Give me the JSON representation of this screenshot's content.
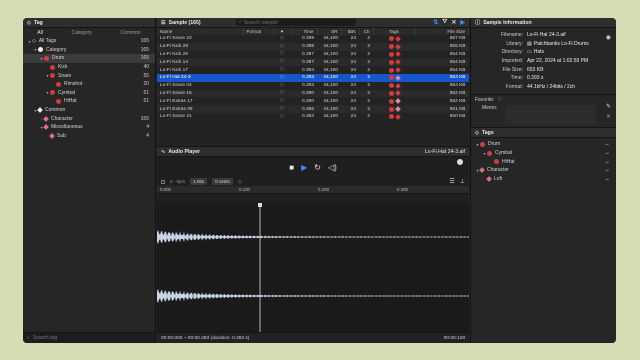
{
  "left": {
    "title": "Tag",
    "tabs": [
      "All",
      "Category",
      "Common"
    ],
    "tree": [
      {
        "indent": 0,
        "chev": "▾",
        "icon": "tag",
        "label": "All Tags",
        "count": "165"
      },
      {
        "indent": 1,
        "chev": "▾",
        "icon": "white",
        "label": "Category",
        "count": "165"
      },
      {
        "indent": 2,
        "chev": "▾",
        "icon": "red",
        "label": "Drum",
        "count": "165",
        "sel": true
      },
      {
        "indent": 3,
        "chev": "",
        "icon": "red",
        "label": "Kick",
        "count": "40"
      },
      {
        "indent": 3,
        "chev": "▾",
        "icon": "red",
        "label": "Snare",
        "count": "55"
      },
      {
        "indent": 4,
        "chev": "",
        "icon": "red",
        "label": "Rimshot",
        "count": "20"
      },
      {
        "indent": 3,
        "chev": "▾",
        "icon": "red",
        "label": "Cymbal",
        "count": "51"
      },
      {
        "indent": 4,
        "chev": "",
        "icon": "red",
        "label": "HiHat",
        "count": "51"
      },
      {
        "indent": 1,
        "chev": "▾",
        "icon": "diamond-white",
        "label": "Common",
        "count": ""
      },
      {
        "indent": 2,
        "chev": "›",
        "icon": "pink",
        "label": "Character",
        "count": "165"
      },
      {
        "indent": 2,
        "chev": "▾",
        "icon": "pink",
        "label": "Miscellaneous",
        "count": "4"
      },
      {
        "indent": 3,
        "chev": "",
        "icon": "pink",
        "label": "Sub",
        "count": "4"
      }
    ],
    "search_placeholder": "Search tag"
  },
  "sample": {
    "title": "Sample (165)",
    "search_placeholder": "Search sample",
    "columns": [
      "Name",
      "Format",
      "♥",
      "Time",
      "SR",
      "Bits",
      "Ch",
      "Tags",
      "File Size"
    ],
    "rows": [
      {
        "name": "Lo-Fi Snare 23",
        "time": "0.399",
        "sr": "44,100",
        "bits": "24",
        "ch": "2",
        "size": "657 KB",
        "tags": "dd"
      },
      {
        "name": "Lo-Fi Kick 29",
        "time": "0.398",
        "sr": "44,100",
        "bits": "24",
        "ch": "2",
        "size": "655 KB",
        "tags": "dd"
      },
      {
        "name": "Lo-Fi Kick 25",
        "time": "0.397",
        "sr": "44,100",
        "bits": "24",
        "ch": "2",
        "size": "654 KB",
        "tags": "dd"
      },
      {
        "name": "Lo-Fi Kick 14",
        "time": "0.397",
        "sr": "44,100",
        "bits": "24",
        "ch": "2",
        "size": "654 KB",
        "tags": "dd"
      },
      {
        "name": "Lo-Fi Kick 17",
        "time": "0.394",
        "sr": "44,100",
        "bits": "24",
        "ch": "2",
        "size": "654 KB",
        "tags": "dd"
      },
      {
        "name": "Lo-Fi Hat 24-3",
        "time": "0.393",
        "sr": "44,100",
        "bits": "24",
        "ch": "2",
        "size": "653 KB",
        "tags": "dp",
        "sel": true
      },
      {
        "name": "Lo-Fi Snare 04",
        "time": "0.393",
        "sr": "44,100",
        "bits": "24",
        "ch": "2",
        "size": "653 KB",
        "tags": "dd"
      },
      {
        "name": "Lo-Fi Snare 16",
        "time": "0.390",
        "sr": "44,100",
        "bits": "24",
        "ch": "2",
        "size": "652 KB",
        "tags": "dd"
      },
      {
        "name": "Lo-Fi Extras 17",
        "time": "0.390",
        "sr": "44,100",
        "bits": "24",
        "ch": "2",
        "size": "652 KB",
        "tags": "dp"
      },
      {
        "name": "Lo-Fi Extras 08",
        "time": "0.386",
        "sr": "44,100",
        "bits": "24",
        "ch": "2",
        "size": "651 KB",
        "tags": "dp"
      },
      {
        "name": "Lo-Fi Snare 21",
        "time": "0.383",
        "sr": "44,100",
        "bits": "24",
        "ch": "2",
        "size": "650 KB",
        "tags": "dd"
      }
    ]
  },
  "player": {
    "title": "Audio Player",
    "file": "Lo-Fi Hat 24-3.aif",
    "pan": "0 · 0pm",
    "speed": "1.00x",
    "pitch": "0 cents",
    "ruler": [
      "0.000",
      "0.100",
      "0.200",
      "0.300"
    ],
    "time_range": "00:00.000 ~ 00:00.393 (duration: 0.393 s)",
    "pos": "00:00:128"
  },
  "info": {
    "title": "Sample Information",
    "fields": [
      {
        "label": "Filename:",
        "value": "Lo-Fi Hat 24-3.aif"
      },
      {
        "label": "Library:",
        "value": "Patchbanks Lo-Fi Drums",
        "icon": "library"
      },
      {
        "label": "Directory:",
        "value": "Hats",
        "icon": "folder"
      },
      {
        "label": "Imported:",
        "value": "Apr 22, 2024 at 1:02:59 PM"
      },
      {
        "label": "File Size:",
        "value": "653 KB"
      },
      {
        "label": "Time:",
        "value": "0.393 s"
      },
      {
        "label": "Format:",
        "value": "44.1kHz / 24bits / 2ch"
      }
    ],
    "favorite_label": "Favorite:",
    "memo_label": "Memo:"
  },
  "tags": {
    "title": "Tags",
    "items": [
      {
        "indent": 0,
        "icon": "red",
        "label": "Drum"
      },
      {
        "indent": 1,
        "icon": "red",
        "label": "Cymbal"
      },
      {
        "indent": 2,
        "icon": "red",
        "label": "HiHat"
      },
      {
        "indent": 0,
        "icon": "pink",
        "label": "Character"
      },
      {
        "indent": 1,
        "icon": "pink",
        "label": "Lofi"
      }
    ]
  }
}
